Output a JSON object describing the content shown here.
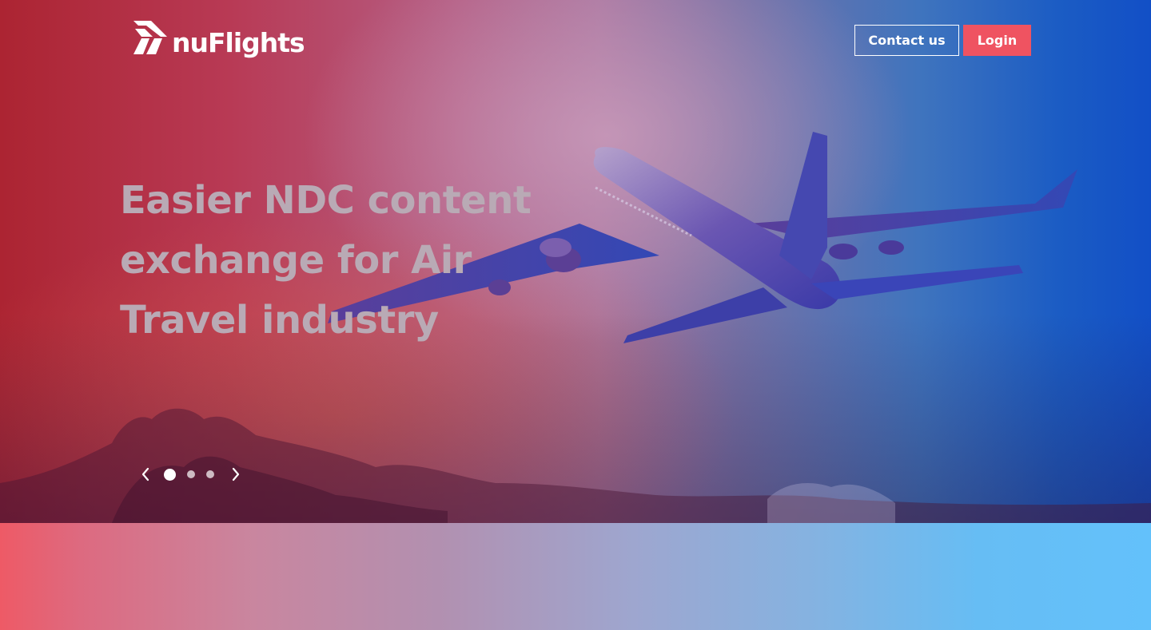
{
  "brand": {
    "name": "nuFlights"
  },
  "header": {
    "contact_label": "Contact us",
    "login_label": "Login"
  },
  "hero": {
    "headline_lines": [
      "Easier NDC content",
      "exchange for Air",
      "Travel industry"
    ]
  },
  "carousel": {
    "slide_count": 3,
    "active_index": 0,
    "prev_icon": "chevron-left-icon",
    "next_icon": "chevron-right-icon"
  },
  "colors": {
    "login_button": "#ef5361",
    "headline_text": "#b9aab5",
    "band_start": "#ee5a66",
    "band_end": "#63c1fb"
  }
}
